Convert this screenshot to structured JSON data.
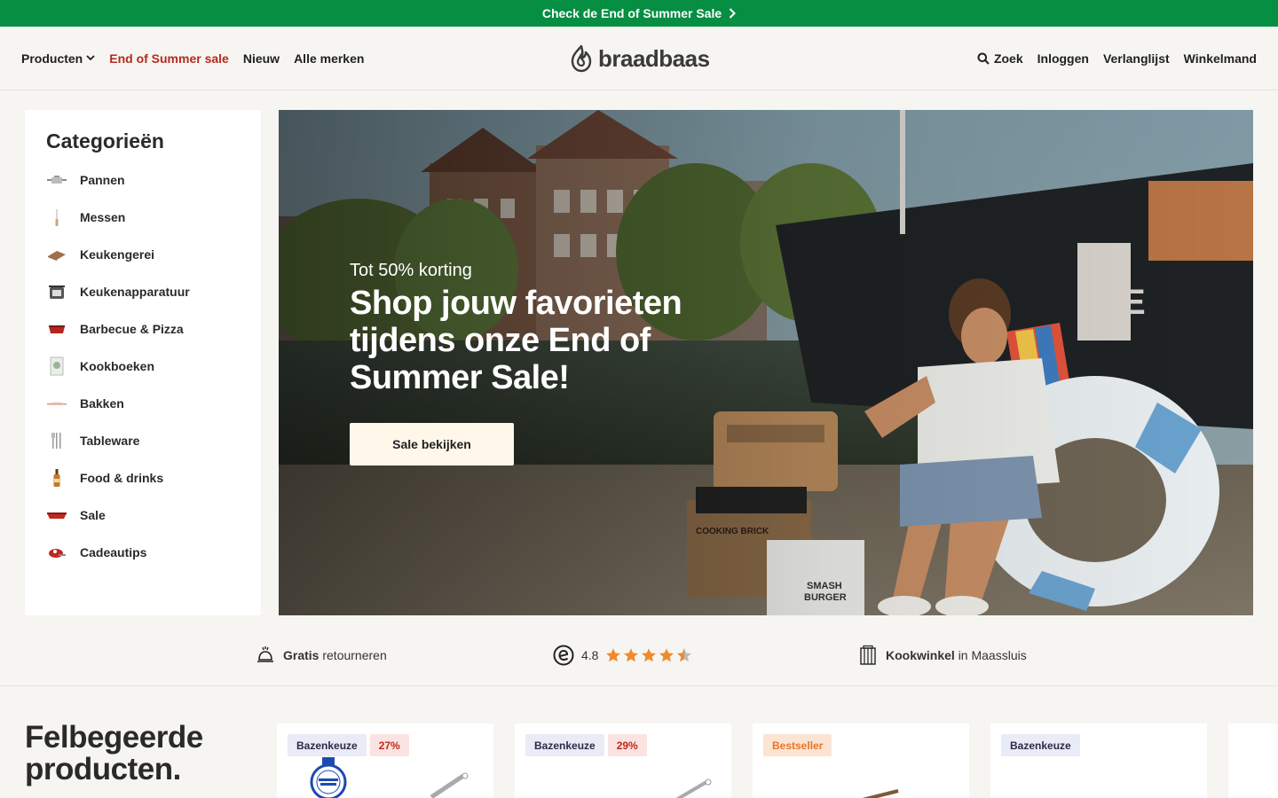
{
  "promo": {
    "text": "Check de End of Summer Sale"
  },
  "header": {
    "nav_left": [
      {
        "label": "Producten"
      },
      {
        "label": "End of Summer sale"
      },
      {
        "label": "Nieuw"
      },
      {
        "label": "Alle merken"
      }
    ],
    "logo": "braadbaas",
    "nav_right": [
      {
        "label": "Zoek"
      },
      {
        "label": "Inloggen"
      },
      {
        "label": "Verlanglijst"
      },
      {
        "label": "Winkelmand"
      }
    ]
  },
  "categories": {
    "title": "Categorieën",
    "items": [
      {
        "label": "Pannen",
        "icon": "pan-icon"
      },
      {
        "label": "Messen",
        "icon": "knife-icon"
      },
      {
        "label": "Keukengerei",
        "icon": "cutting-board-icon"
      },
      {
        "label": "Keukenapparatuur",
        "icon": "appliance-icon"
      },
      {
        "label": "Barbecue & Pizza",
        "icon": "bbq-icon"
      },
      {
        "label": "Kookboeken",
        "icon": "cookbook-icon"
      },
      {
        "label": "Bakken",
        "icon": "rolling-pin-icon"
      },
      {
        "label": "Tableware",
        "icon": "cutlery-icon"
      },
      {
        "label": "Food & drinks",
        "icon": "bottle-icon"
      },
      {
        "label": "Sale",
        "icon": "sale-dish-icon"
      },
      {
        "label": "Cadeautips",
        "icon": "gift-icon"
      }
    ]
  },
  "hero": {
    "subtitle": "Tot 50% korting",
    "title": "Shop jouw favorieten tijdens onze End of Summer Sale!",
    "button": "Sale bekijken"
  },
  "usp": {
    "returns_bold": "Gratis",
    "returns_rest": "retourneren",
    "rating": "4.8",
    "rating_stars": 4.5,
    "store_bold": "Kookwinkel",
    "store_rest": "in Maassluis"
  },
  "featured": {
    "title": "Felbegeerde producten.",
    "cards": [
      {
        "badges": [
          "Bazenkeuze",
          "27%"
        ]
      },
      {
        "badges": [
          "Bazenkeuze",
          "29%"
        ]
      },
      {
        "badges": [
          "Bestseller"
        ]
      },
      {
        "badges": [
          "Bazenkeuze"
        ]
      }
    ]
  },
  "colors": {
    "promo": "#068e43",
    "sale": "#b32a1f",
    "background": "#f6f5f1",
    "star": "#f08a2c"
  }
}
